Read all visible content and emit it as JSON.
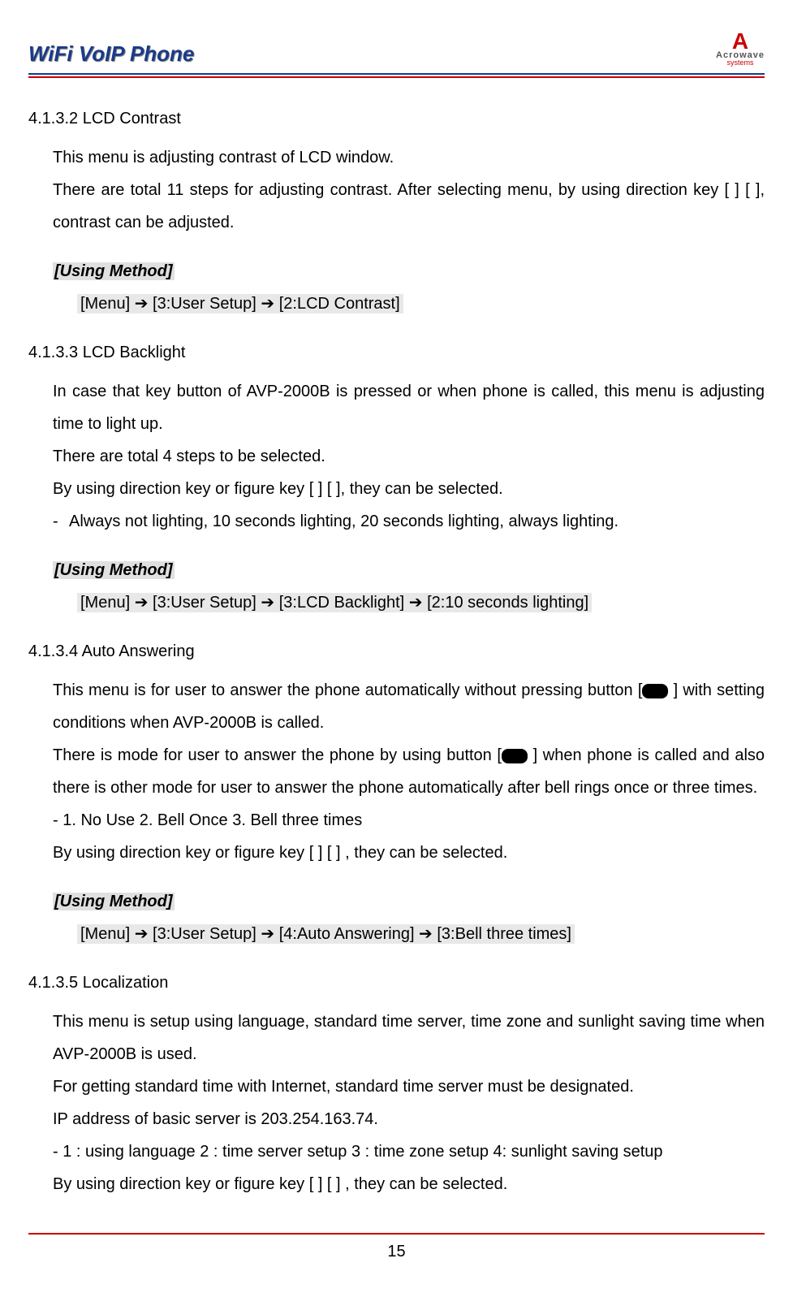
{
  "header": {
    "title": "WiFi VoIP Phone",
    "logo": {
      "name": "Acrowave",
      "sub": "systems"
    }
  },
  "page_number": "15",
  "sections": [
    {
      "heading": "4.1.3.2 LCD Contrast",
      "para1": "This menu is adjusting contrast of LCD window.",
      "para2": "There are total 11 steps for adjusting contrast.    After selecting menu, by using direction key [    ]    [    ], contrast can be adjusted.",
      "using_method_label": "[Using Method]",
      "using_method_path": "[Menu] ➔ [3:User Setup] ➔ [2:LCD Contrast]"
    },
    {
      "heading": "4.1.3.3 LCD Backlight",
      "para1": "In  case  that  key  button  of  AVP-2000B  is  pressed  or  when  phone  is  called,  this  menu  is adjusting time to light up.",
      "para2": "There are total 4 steps to be selected.",
      "para3": "By using direction key or figure key [    ]    [    ], they can be selected.",
      "list1_prefix": "- ",
      "list1": "Always not lighting,      10 seconds lighting,    20 seconds lighting,    always lighting.",
      "using_method_label": "[Using Method]",
      "using_method_path": "[Menu] ➔ [3:User Setup] ➔ [3:LCD Backlight] ➔ [2:10 seconds lighting]"
    },
    {
      "heading": "4.1.3.4 Auto Answering",
      "para1_a": "This menu is for user to answer the phone automatically without pressing button [",
      "para1_b": " ] with setting conditions when AVP-2000B is called.",
      "para2_a": "There is mode for user to answer the phone by using button [",
      "para2_b": " ] when phone is called and also there is other mode for user to answer the phone automatically after bell rings once or three times.",
      "list1": "- 1. No Use      2. Bell Once        3. Bell three times",
      "para3": "By using direction key or figure key [    ]    [    ] , they can be selected.",
      "using_method_label": "[Using Method]",
      "using_method_path": "[Menu] ➔ [3:User Setup] ➔ [4:Auto Answering] ➔ [3:Bell three times]"
    },
    {
      "heading": "4.1.3.5 Localization",
      "para1": "This menu is setup using language, standard time server, time zone and sunlight saving time when AVP-2000B is used.",
      "para2": "For getting standard time with Internet, standard time server must be designated.",
      "para3": "IP address of basic server is 203.254.163.74.",
      "list1": "- 1 : using language      2 : time server setup    3 : time zone setup    4: sunlight saving setup",
      "para4": "By using direction key or figure key [    ]    [    ] , they can be selected."
    }
  ]
}
